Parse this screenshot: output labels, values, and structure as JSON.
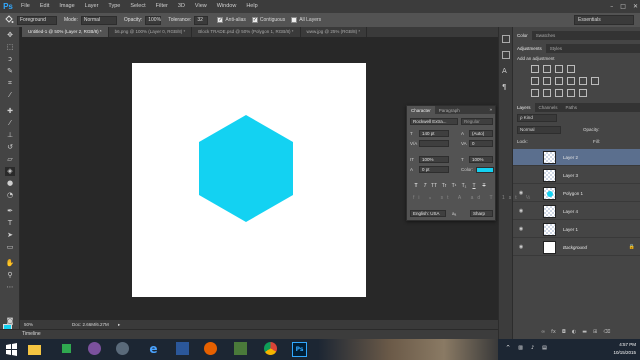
{
  "app": {
    "logo": "Ps"
  },
  "menu": [
    "File",
    "Edit",
    "Image",
    "Layer",
    "Type",
    "Select",
    "Filter",
    "3D",
    "View",
    "Window",
    "Help"
  ],
  "window_controls": {
    "minimize": "–",
    "maximize": "□",
    "close": "✕"
  },
  "options_bar": {
    "tool_preset": "Foreground",
    "mode_label": "Mode:",
    "mode_value": "Normal",
    "opacity_label": "Opacity:",
    "opacity_value": "100%",
    "tolerance_label": "Tolerance:",
    "tolerance_value": "32",
    "anti_alias": "Anti-alias",
    "contiguous": "Contiguous",
    "all_layers": "All Layers",
    "workspace": "Essentials"
  },
  "tabs": [
    {
      "label": "Untitled-1 @ 50% (Layer 2, RGB/8) *",
      "active": true
    },
    {
      "label": "b6.png @ 100% (Layer 0, RGB/8) *",
      "active": false
    },
    {
      "label": "Block TRADE.psd @ 50% (Polygon 1, RGB/8) *",
      "active": false
    },
    {
      "label": "www.jpg @ 25% (RGB/8) *",
      "active": false
    }
  ],
  "colors": {
    "foreground": "#13d2f2",
    "background": "#000000",
    "hexagon": "#13d2f2",
    "selection": "#5b6f8e"
  },
  "status": {
    "zoom": "50%",
    "doc": "Doc: 2.66M/6.27M"
  },
  "timeline_label": "Timeline",
  "char_panel": {
    "tab_character": "Character",
    "tab_paragraph": "Paragraph",
    "font_family": "Rockwell Extra...",
    "font_style": "Regular",
    "font_size": "140 pt",
    "leading": "(Auto)",
    "tracking": "0",
    "vertical_scale": "100%",
    "horizontal_scale": "100%",
    "baseline_shift": "0 pt",
    "color_label": "Color:",
    "language": "English: USA",
    "aa_label": "aₐ",
    "antialias": "Sharp",
    "styles": [
      "T",
      "T",
      "TT",
      "Tr",
      "T¹",
      "T₁",
      "T",
      "T"
    ]
  },
  "right_panel": {
    "color_tabs": [
      "Color",
      "Swatches"
    ],
    "adjust_tabs": [
      "Adjustments",
      "Styles"
    ],
    "add_adjustment": "Add an adjustment",
    "layers_tabs": [
      "Layers",
      "Channels",
      "Paths"
    ],
    "kind_label": "ρ Kind",
    "blend_mode": "Normal",
    "opacity_label": "Opacity:",
    "lock_label": "Lock:",
    "fill_label": "Fill:"
  },
  "layers": [
    {
      "name": "Layer 2",
      "selected": true,
      "visible": false,
      "thumb": "transparent"
    },
    {
      "name": "Layer 3",
      "selected": false,
      "visible": false,
      "thumb": "transparent"
    },
    {
      "name": "Polygon 1",
      "selected": false,
      "visible": true,
      "thumb": "dot"
    },
    {
      "name": "Layer 4",
      "selected": false,
      "visible": true,
      "thumb": "transparent"
    },
    {
      "name": "Layer 1",
      "selected": false,
      "visible": true,
      "thumb": "transparent"
    },
    {
      "name": "Background",
      "selected": false,
      "visible": true,
      "thumb": "white"
    }
  ],
  "clock": {
    "time": "4:57 PM",
    "date": "10/15/2015"
  }
}
